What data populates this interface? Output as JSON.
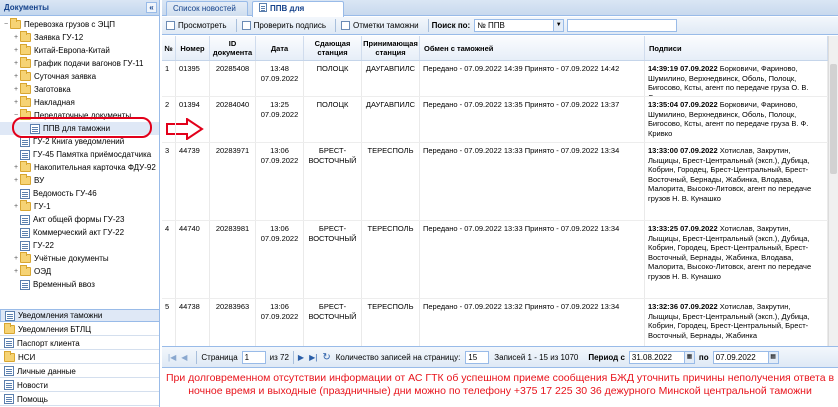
{
  "sidebar": {
    "title": "Документы",
    "collapse_icon": "«",
    "tree": [
      {
        "label": "Перевозка грузов с ЭЦП",
        "type": "folder",
        "expanded": true,
        "indent": 0
      },
      {
        "label": "Заявка ГУ-12",
        "type": "folder",
        "indent": 1
      },
      {
        "label": "Китай-Европа-Китай",
        "type": "folder",
        "indent": 1
      },
      {
        "label": "График подачи вагонов ГУ-11",
        "type": "folder",
        "indent": 1
      },
      {
        "label": "Суточная заявка",
        "type": "folder",
        "indent": 1
      },
      {
        "label": "Заготовка",
        "type": "folder",
        "indent": 1
      },
      {
        "label": "Накладная",
        "type": "folder",
        "indent": 1
      },
      {
        "label": "Передаточные документы",
        "type": "folder",
        "expanded": true,
        "indent": 1
      },
      {
        "label": "ППВ для таможни",
        "type": "doc",
        "indent": 2,
        "selected": true
      },
      {
        "label": "ГУ-2 Книга уведомлений",
        "type": "doc",
        "indent": 1
      },
      {
        "label": "ГУ-45 Памятка приёмосдатчика",
        "type": "doc",
        "indent": 1
      },
      {
        "label": "Накопительная карточка ФДУ-92",
        "type": "folder",
        "indent": 1
      },
      {
        "label": "ВУ",
        "type": "folder",
        "indent": 1
      },
      {
        "label": "Ведомость ГУ-46",
        "type": "doc",
        "indent": 1
      },
      {
        "label": "ГУ-1",
        "type": "folder",
        "indent": 1
      },
      {
        "label": "Акт общей формы ГУ-23",
        "type": "doc",
        "indent": 1
      },
      {
        "label": "Коммерческий акт ГУ-22",
        "type": "doc",
        "indent": 1
      },
      {
        "label": "ГУ-22",
        "type": "doc",
        "indent": 1
      },
      {
        "label": "Учётные документы",
        "type": "folder",
        "indent": 1
      },
      {
        "label": "ОЭД",
        "type": "folder",
        "indent": 1
      },
      {
        "label": "Временный ввоз",
        "type": "doc",
        "indent": 1
      }
    ],
    "accordion": [
      {
        "label": "Уведомления таможни",
        "highlight": true
      },
      {
        "label": "Уведомления БТЛЦ"
      },
      {
        "label": "Паспорт клиента"
      },
      {
        "label": "НСИ"
      },
      {
        "label": "Личные данные"
      },
      {
        "label": "Новости"
      },
      {
        "label": "Помощь"
      }
    ]
  },
  "tabs": [
    {
      "label": "Список новостей",
      "active": false
    },
    {
      "label": "ППВ для таможни",
      "active": true
    }
  ],
  "toolbar": {
    "view": "Просмотреть",
    "check_sign": "Проверить подпись",
    "customs_marks": "Отметки таможни",
    "search_label": "Поиск по:",
    "search_field": "№ ППВ",
    "search_value": ""
  },
  "grid": {
    "columns": [
      "№",
      "Номер",
      "ID документа",
      "Дата",
      "Сдающая станция",
      "Принимающая станция",
      "Обмен с таможней",
      "Подписи"
    ],
    "rows": [
      {
        "n": "1",
        "num": "01395",
        "id": "20285408",
        "date": "13:48 07.09.2022",
        "from": "ПОЛОЦК",
        "to": "ДАУГАВПИЛС",
        "exchange": "Передано - 07.09.2022 14:39 Принято - 07.09.2022 14:42",
        "sign_time": "14:39:19 07.09.2022",
        "sign_text": "Борковичи, Фариново, Шумилино, Верхнедвинск, Оболь, Полоцк, Бигосово, Ксты, агент по передаче груза О. В. Степаненко"
      },
      {
        "n": "2",
        "num": "01394",
        "id": "20284040",
        "date": "13:25 07.09.2022",
        "from": "ПОЛОЦК",
        "to": "ДАУГАВПИЛС",
        "exchange": "Передано - 07.09.2022 13:35 Принято - 07.09.2022 13:37",
        "sign_time": "13:35:04 07.09.2022",
        "sign_text": "Борковичи, Фариново, Шумилино, Верхнедвинск, Оболь, Полоцк, Бигосово, Ксты, агент по передаче груза В. Ф. Кривко"
      },
      {
        "n": "3",
        "num": "44739",
        "id": "20283971",
        "date": "13:06 07.09.2022",
        "from": "БРЕСТ-ВОСТОЧНЫЙ",
        "to": "ТЕРЕСПОЛЬ",
        "exchange": "Передано - 07.09.2022 13:33 Принято - 07.09.2022 13:34",
        "sign_time": "13:33:00 07.09.2022",
        "sign_text": "Хотислав, Закрутин, Лыщицы, Брест-Центральный (эксп.), Дубица, Кобрин, Городец, Брест-Центральный, Брест-Восточный, Бернады, Жабинка, Влодава, Малорита, Высоко-Литовск, агент по передаче грузов Н. В. Кунашко"
      },
      {
        "n": "4",
        "num": "44740",
        "id": "20283981",
        "date": "13:06 07.09.2022",
        "from": "БРЕСТ-ВОСТОЧНЫЙ",
        "to": "ТЕРЕСПОЛЬ",
        "exchange": "Передано - 07.09.2022 13:33 Принято - 07.09.2022 13:34",
        "sign_time": "13:33:25 07.09.2022",
        "sign_text": "Хотислав, Закрутин, Лыщицы, Брест-Центральный (эксп.), Дубица, Кобрин, Городец, Брест-Центральный, Брест-Восточный, Бернады, Жабинка, Влодава, Малорита, Высоко-Литовск, агент по передаче грузов Н. В. Кунашко"
      },
      {
        "n": "5",
        "num": "44738",
        "id": "20283963",
        "date": "13:06 07.09.2022",
        "from": "БРЕСТ-ВОСТОЧНЫЙ",
        "to": "ТЕРЕСПОЛЬ",
        "exchange": "Передано - 07.09.2022 13:32 Принято - 07.09.2022 13:34",
        "sign_time": "13:32:36 07.09.2022",
        "sign_text": "Хотислав, Закрутин, Лыщицы, Брест-Центральный (эксп.), Дубица, Кобрин, Городец, Брест-Центральный, Брест-Восточный, Бернады, Жабинка"
      }
    ]
  },
  "pager": {
    "page_label": "Страница",
    "page": "1",
    "of": "из 72",
    "per_page_label": "Количество записей на страницу:",
    "per_page": "15",
    "records": "Записей 1 - 15 из 1070",
    "period_label": "Период с",
    "date_from": "31.08.2022",
    "to_label": "по",
    "date_to": "07.09.2022"
  },
  "notice": "При долговременном отсутствии информации от АС ГТК об успешном приеме сообщения БЖД уточнить причины неполучения ответа в ночное время и выходные (праздничные) дни можно по телефону +375 17 225 30 36 дежурного Минской центральной таможни",
  "colors": {
    "highlight_red": "#e2001a",
    "notice_red": "#e8141c",
    "header_blue": "#15428b"
  }
}
